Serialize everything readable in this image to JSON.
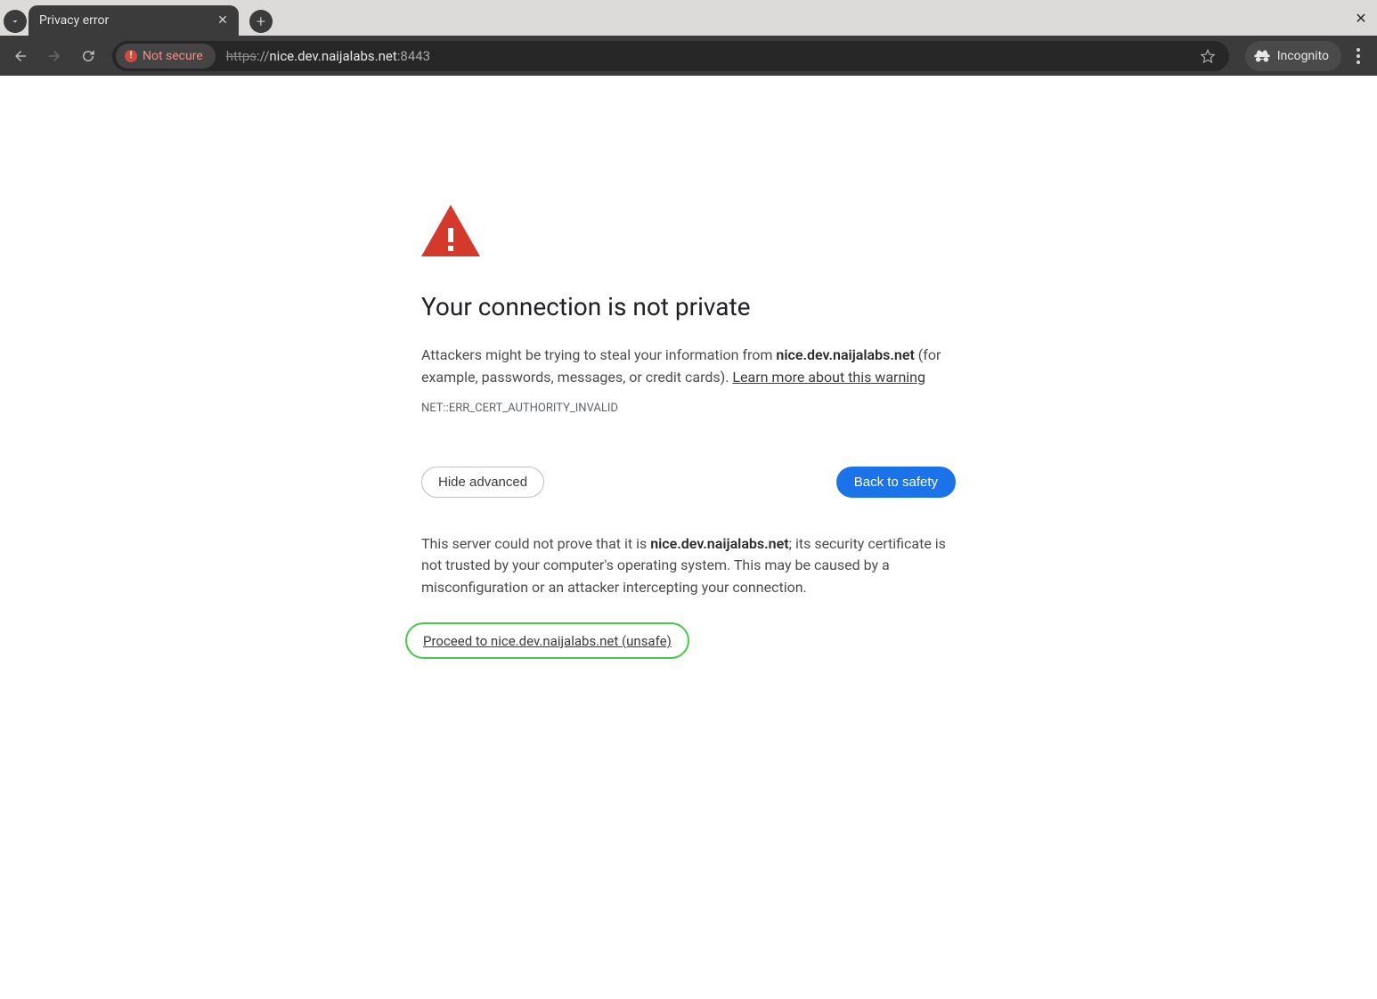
{
  "browser": {
    "tab_title": "Privacy error",
    "security_chip": "Not secure",
    "url_scheme": "https",
    "url_sep": "://",
    "url_host": "nice.dev.naijalabs.net",
    "url_port": ":8443",
    "incognito_label": "Incognito"
  },
  "page": {
    "heading": "Your connection is not private",
    "warn_prefix": "Attackers might be trying to steal your information from ",
    "warn_domain": "nice.dev.naijalabs.net",
    "warn_suffix": " (for example, passwords, messages, or credit cards). ",
    "learn_more": "Learn more about this warning",
    "error_code": "NET::ERR_CERT_AUTHORITY_INVALID",
    "hide_advanced": "Hide advanced",
    "back_to_safety": "Back to safety",
    "adv_prefix": "This server could not prove that it is ",
    "adv_domain": "nice.dev.naijalabs.net",
    "adv_suffix": "; its security certificate is not trusted by your computer's operating system. This may be caused by a misconfiguration or an attacker intercepting your connection.",
    "proceed": "Proceed to nice.dev.naijalabs.net (unsafe)"
  }
}
